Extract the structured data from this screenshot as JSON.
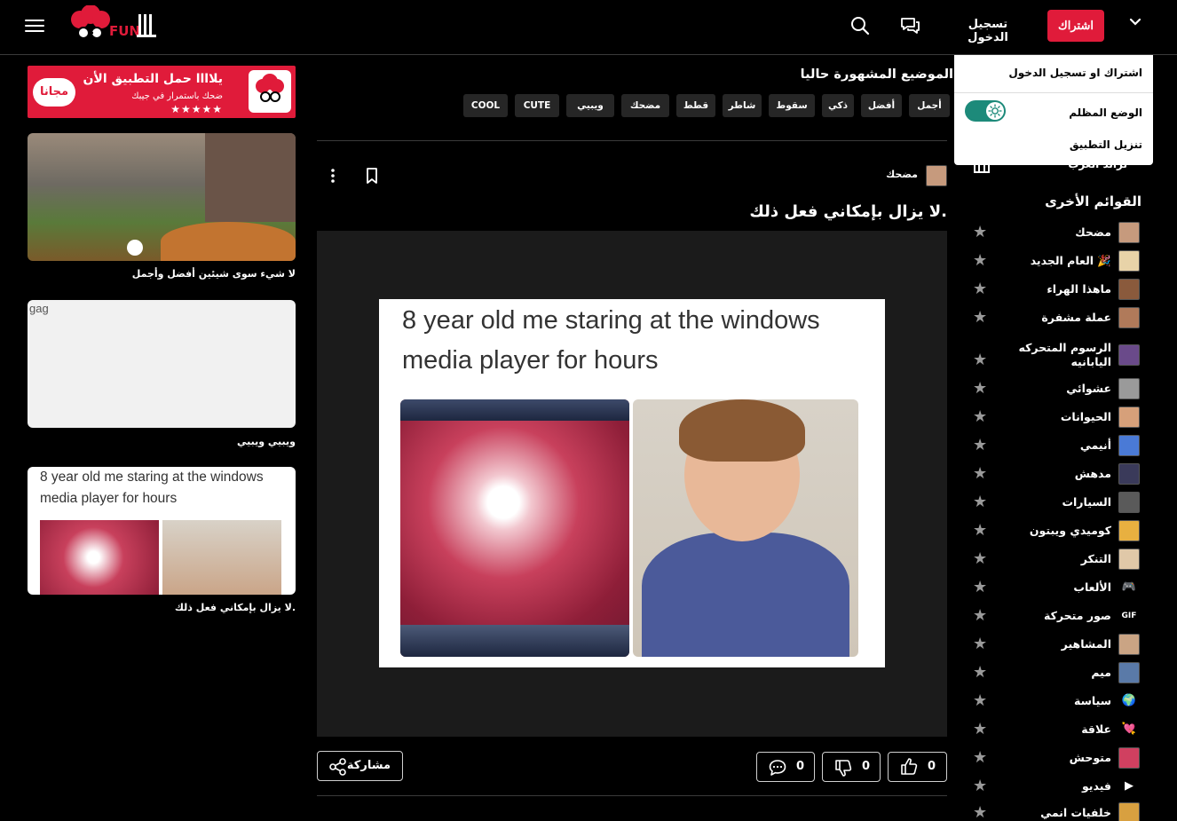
{
  "header": {
    "logo_text": "يلاااFUN",
    "signup_label": "اشتراك",
    "login_label": "تسجيل الدخول"
  },
  "dropdown": {
    "signup_or_login": "اشتراك او تسجيل الدخول",
    "dark_mode": "الوضع المظلم",
    "download_app": "تنزيل التطبيق",
    "dark_mode_enabled": true
  },
  "sidebar": {
    "partial_item": "تراند العرب",
    "heading": "القوائم الأخرى",
    "items": [
      {
        "label": "مضحك",
        "color": "#c69a7d"
      },
      {
        "label": "العام الجديد 🎉",
        "color": "#e8d3a8"
      },
      {
        "label": "ماهذا الهراء",
        "color": "#8a5a3c"
      },
      {
        "label": "عملة مشفرة",
        "color": "#b07a5a"
      },
      {
        "label": "الرسوم المتحركه اليابانيه",
        "color": "#6a4a8a"
      },
      {
        "label": "عشوائي",
        "color": "#9a9a9a"
      },
      {
        "label": "الحيوانات",
        "color": "#d6a07a"
      },
      {
        "label": "أنيمي",
        "color": "#4a7ad6"
      },
      {
        "label": "مدهش",
        "color": "#3a3a5a"
      },
      {
        "label": "السيارات",
        "color": "#5a5a5a"
      },
      {
        "label": "كوميدي ويبتون",
        "color": "#e8b040"
      },
      {
        "label": "التنكر",
        "color": "#e0c8a8"
      },
      {
        "label": "الألعاب",
        "color": "#000000"
      },
      {
        "label": "صور متحركة",
        "color": "#000000"
      },
      {
        "label": "المشاهير",
        "color": "#caa484"
      },
      {
        "label": "ميم",
        "color": "#5a7aa8"
      },
      {
        "label": "سياسة",
        "color": "#2a80c8"
      },
      {
        "label": "علاقة",
        "color": "#e03050"
      },
      {
        "label": "متوحش",
        "color": "#d04060"
      },
      {
        "label": "فيديو",
        "color": "#000000"
      },
      {
        "label": "خلفيات انمي",
        "color": "#d8a040"
      }
    ],
    "icons": {
      "الألعاب": "🎮",
      "صور متحركة": "GIF",
      "سياسة": "🌍",
      "علاقة": "💘",
      "فيديو": "▶"
    }
  },
  "trending": {
    "title": "الموضيع المشهورة حاليا",
    "tags": [
      "أجمل",
      "أفضل",
      "ذكي",
      "سقوط",
      "شاطر",
      "قطط",
      "مضحك",
      "ويبيي",
      "CUTE",
      "COOL"
    ]
  },
  "post": {
    "category": "مضحك",
    "title": "لا يزال بإمكاني فعل ذلك.",
    "meme_caption": "8 year old me staring at the windows media player for hours",
    "likes": "0",
    "dislikes": "0",
    "comments": "0",
    "share_label": "مشاركة"
  },
  "promo": {
    "title": "يلاااا حمل التطبيق الأن",
    "subtitle": "ضحك باستمرار في جيبك",
    "stars": "★★★★★",
    "free_label": "مجانا"
  },
  "related": [
    {
      "caption": "لا شيء سوى شيئين أفضل وأجمل",
      "type": "photo"
    },
    {
      "caption": "ويبيي ويبيي",
      "type": "broken",
      "alt": "gag"
    },
    {
      "caption": "لا يزال بإمكاني فعل ذلك.",
      "type": "meme",
      "meme_caption": "8 year old me staring at the windows media player for hours"
    }
  ]
}
